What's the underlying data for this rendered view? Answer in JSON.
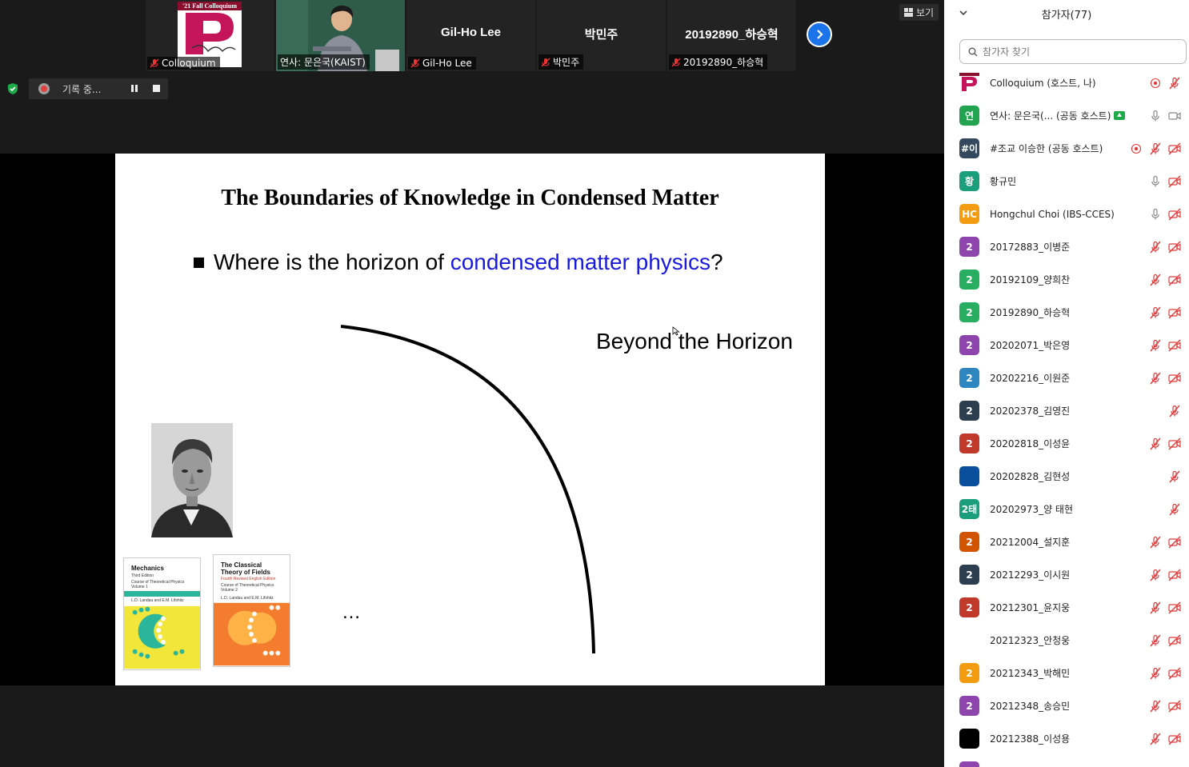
{
  "gallery": {
    "tiles": [
      {
        "label": "Colloquium",
        "logo_banner": "'21 Fall Colloquium"
      },
      {
        "label": "연사: 문은국(KAIST)"
      },
      {
        "name": "Gil-Ho Lee",
        "label": "Gil-Ho Lee"
      },
      {
        "name": "박민주",
        "label": "박민주"
      },
      {
        "name": "20192890_하승혁",
        "label": "20192890_하승혁"
      }
    ],
    "next_icon": "chevron-right-icon"
  },
  "view_button": {
    "label": "보기",
    "icon": "view-grid-icon"
  },
  "recording": {
    "label": "기록 중...",
    "icons": [
      "record-dot-icon",
      "pause-icon",
      "stop-icon"
    ]
  },
  "slide": {
    "title": "The Boundaries of Knowledge in Condensed Matter",
    "bullet_prefix": "Where is the horizon of ",
    "bullet_highlight": "condensed matter physics",
    "bullet_suffix": "?",
    "beyond": "Beyond the Horizon",
    "ellipsis": "…",
    "highlight_color": "#1a1adf",
    "books": [
      {
        "title_line1": "Mechanics",
        "edition": "Third Edition",
        "series": "Course of Theoretical Physics",
        "volume": "Volume 1",
        "authors": "L.D. Landau and E.M. Lifshitz",
        "colors": {
          "band": "#2bb59a",
          "art": "#f2e63a",
          "circle": "#2bb59a"
        }
      },
      {
        "title_line1": "The Classical",
        "title_line2": "Theory of Fields",
        "edition": "Fourth Revised English Edition",
        "series": "Course of Theoretical Physics",
        "volume": "Volume 2",
        "authors": "L.D. Landau and E.M. Lifshitz",
        "colors": {
          "band": "#f37c2f",
          "art": "#f37c2f",
          "circle": "#ffb347"
        }
      }
    ]
  },
  "participants": {
    "title": "참가자(77)",
    "search_placeholder": "참가자 찾기",
    "list": [
      {
        "avatar": "P",
        "color": "#ffffff",
        "name": "Colloquium (호스트, 나)",
        "icons": [
          "record-icon",
          "mic-muted-icon"
        ]
      },
      {
        "avatar": "연",
        "color": "#22a350",
        "name": "연사: 문은국(...  (공동 호스트)",
        "share_badge": true,
        "icons": [
          "mic-icon",
          "video-icon"
        ]
      },
      {
        "avatar": "#이",
        "color": "#34495e",
        "name": "#조교 이승한 (공동 호스트)",
        "icons": [
          "record-icon",
          "mic-muted-icon",
          "video-off-icon"
        ]
      },
      {
        "avatar": "황",
        "color": "#1a9e7c",
        "name": "황규민",
        "icons": [
          "mic-icon",
          "video-off-icon"
        ]
      },
      {
        "avatar": "HC",
        "color": "#f39c12",
        "name": "Hongchul Choi (IBS-CCES)",
        "icons": [
          "mic-icon",
          "video-off-icon"
        ]
      },
      {
        "avatar": "2",
        "color": "#8e44ad",
        "name": "20172883_이병준",
        "icons": [
          "mic-muted-icon",
          "video-off-icon"
        ]
      },
      {
        "avatar": "2",
        "color": "#27ae60",
        "name": "20192109_양희찬",
        "icons": [
          "mic-muted-icon",
          "video-off-icon"
        ]
      },
      {
        "avatar": "2",
        "color": "#27ae60",
        "name": "20192890_하승혁",
        "icons": [
          "mic-muted-icon",
          "video-off-icon"
        ]
      },
      {
        "avatar": "2",
        "color": "#8e44ad",
        "name": "20202071_박은영",
        "icons": [
          "mic-muted-icon",
          "video-off-icon"
        ]
      },
      {
        "avatar": "2",
        "color": "#2e86c1",
        "name": "20202216_이원준",
        "icons": [
          "mic-muted-icon",
          "video-off-icon"
        ]
      },
      {
        "avatar": "2",
        "color": "#2c3e50",
        "name": "20202378_김영진",
        "icons": [
          "mic-muted-icon"
        ]
      },
      {
        "avatar": "2",
        "color": "#c0392b",
        "name": "20202818_이성윤",
        "icons": [
          "mic-muted-icon",
          "video-off-icon"
        ]
      },
      {
        "avatar": "",
        "color": "#0a4f9e",
        "name": "20202828_김현성",
        "icons": [
          "mic-muted-icon"
        ]
      },
      {
        "avatar": "2태",
        "color": "#1a9e7c",
        "name": "20202973_양 태현",
        "icons": [
          "mic-muted-icon"
        ]
      },
      {
        "avatar": "2",
        "color": "#d35400",
        "name": "20212004_설지훈",
        "icons": [
          "mic-muted-icon",
          "video-off-icon"
        ]
      },
      {
        "avatar": "2",
        "color": "#2c3e50",
        "name": "20212293_이시원",
        "icons": [
          "mic-muted-icon",
          "video-off-icon"
        ]
      },
      {
        "avatar": "2",
        "color": "#c0392b",
        "name": "20212301_윤지웅",
        "icons": [
          "mic-muted-icon",
          "video-off-icon"
        ]
      },
      {
        "avatar": "",
        "color": "#ffffff",
        "name": "20212323_안청웅",
        "icons": [
          "mic-muted-icon",
          "video-off-icon"
        ]
      },
      {
        "avatar": "2",
        "color": "#f39c12",
        "name": "20212343_박해민",
        "icons": [
          "mic-muted-icon",
          "video-off-icon"
        ]
      },
      {
        "avatar": "2",
        "color": "#8e44ad",
        "name": "20212348_송승민",
        "icons": [
          "mic-muted-icon",
          "video-off-icon"
        ]
      },
      {
        "avatar": "",
        "color": "#000000",
        "name": "20212388_이성용",
        "icons": [
          "mic-muted-icon",
          "video-off-icon"
        ]
      },
      {
        "avatar": "",
        "color": "#8e44ad",
        "name": "",
        "icons": []
      }
    ]
  }
}
